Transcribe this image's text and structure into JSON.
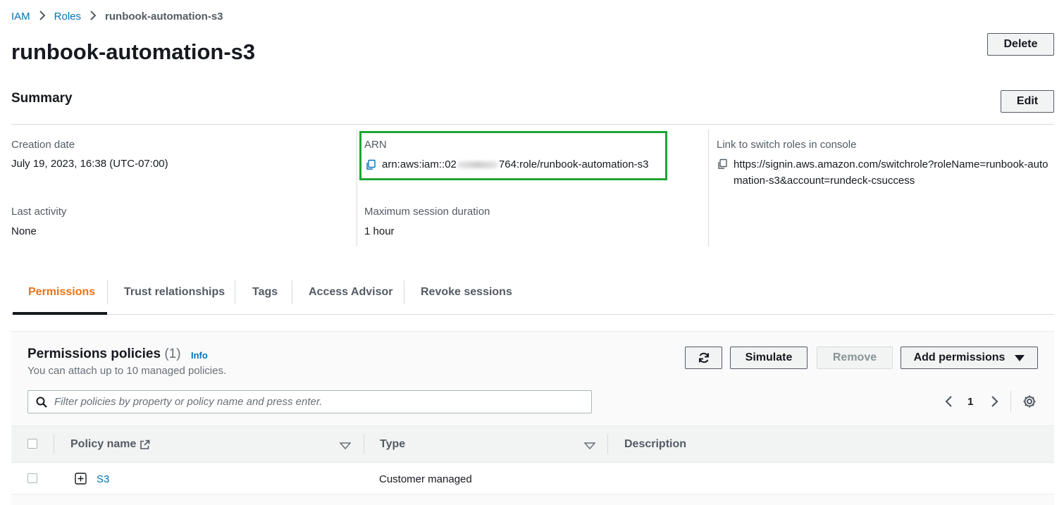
{
  "breadcrumb": {
    "items": [
      "IAM",
      "Roles"
    ],
    "current": "runbook-automation-s3",
    "separator": "›"
  },
  "page": {
    "title": "runbook-automation-s3"
  },
  "header_actions": {
    "delete_label": "Delete"
  },
  "summary": {
    "title": "Summary",
    "edit_label": "Edit",
    "creation_date_label": "Creation date",
    "creation_date_value": "July 19, 2023, 16:38 (UTC-07:00)",
    "arn_label": "ARN",
    "arn_prefix": "arn:aws:iam::02",
    "arn_suffix": "764:role/runbook-automation-s3",
    "switch_link_label": "Link to switch roles in console",
    "switch_link_value": "https://signin.aws.amazon.com/switchrole?roleName=runbook-automation-s3&account=rundeck-csuccess",
    "last_activity_label": "Last activity",
    "last_activity_value": "None",
    "max_session_label": "Maximum session duration",
    "max_session_value": "1 hour",
    "highlight_color": "#1ea535"
  },
  "tabs": [
    {
      "label": "Permissions",
      "active": true
    },
    {
      "label": "Trust relationships",
      "active": false
    },
    {
      "label": "Tags",
      "active": false
    },
    {
      "label": "Access Advisor",
      "active": false
    },
    {
      "label": "Revoke sessions",
      "active": false
    }
  ],
  "policies": {
    "title": "Permissions policies",
    "count": "(1)",
    "info_label": "Info",
    "subtitle": "You can attach up to 10 managed policies.",
    "refresh_icon": "refresh-icon",
    "simulate_label": "Simulate",
    "remove_label": "Remove",
    "add_permissions_label": "Add permissions",
    "search_placeholder": "Filter policies by property or policy name and press enter.",
    "page_number": "1",
    "columns": [
      "Policy name",
      "Type",
      "Description"
    ],
    "rows": [
      {
        "name": "S3",
        "type": "Customer managed",
        "description": ""
      }
    ]
  },
  "colors": {
    "link": "#0073bb",
    "active_tab": "#ec7211",
    "text": "#16191f"
  }
}
